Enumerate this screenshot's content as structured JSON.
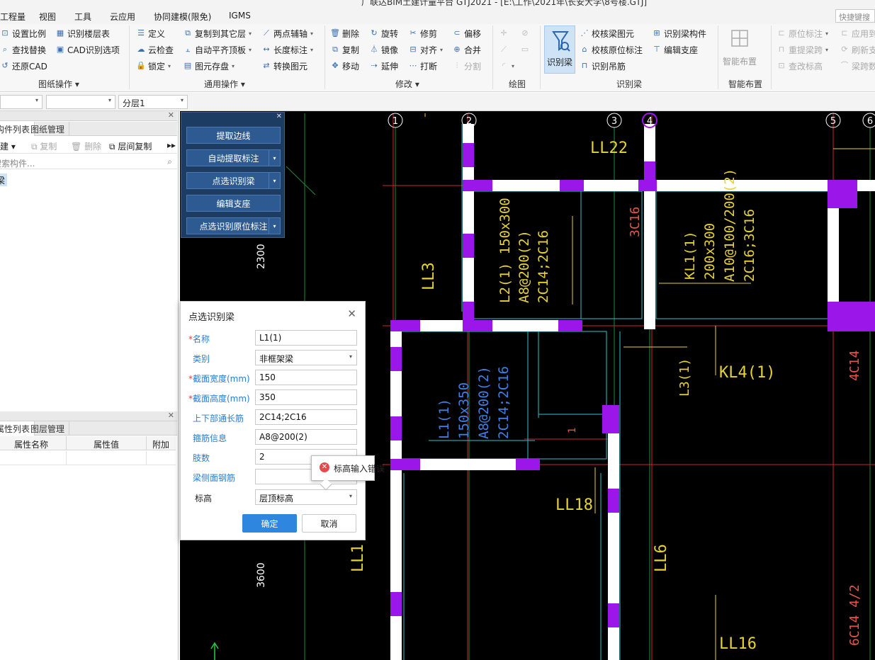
{
  "window": {
    "title": "广联达BIM土建计量平台 GTJ2021 - [E:\\工作\\2021年\\长安大学\\8号楼.GTJ]",
    "quick_search": "快捷键搜"
  },
  "menu": [
    "工程量",
    "视图",
    "工具",
    "云应用",
    "协同建模(限免)",
    "IGMS"
  ],
  "ribbon": {
    "groups": {
      "drawing_ops": "图纸操作",
      "general_ops": "通用操作",
      "modify": "修改",
      "draw": "绘图",
      "recognize_beam": "识别梁",
      "smart_layout": "智能布置"
    },
    "drawing_ops": [
      "设置比例",
      "识别楼层表",
      "查找替换",
      "CAD识别选项",
      "还原CAD"
    ],
    "general_ops": [
      "定义",
      "复制到其它层",
      "两点辅轴",
      "云检查",
      "自动平齐顶板",
      "长度标注",
      "锁定",
      "图元存盘",
      "转换图元"
    ],
    "modify": [
      "删除",
      "旋转",
      "修剪",
      "偏移",
      "复制",
      "镜像",
      "对齐",
      "合并",
      "移动",
      "延伸",
      "打断",
      "分割"
    ],
    "recognize_beam": {
      "big_button": "识别梁",
      "items": [
        "校核梁图元",
        "识别梁构件",
        "校核原位标注",
        "编辑支座",
        "识别吊筋"
      ]
    },
    "smart_layout": "智能布置",
    "right_items": [
      "原位标注",
      "应用到",
      "重提梁跨",
      "刷新支",
      "查改标高",
      "梁跨数"
    ]
  },
  "toolbar": {
    "combo3": "分层1"
  },
  "left_panel": {
    "tabs_top": [
      "构件列表",
      "图纸管理"
    ],
    "tools": [
      "新建",
      "复制",
      "删除",
      "层间复制"
    ],
    "search_placeholder": "搜索构件...",
    "tree_item": "梁",
    "tabs_bottom": [
      "属性列表",
      "图层管理"
    ],
    "prop_headers": [
      "属性名称",
      "属性值",
      "附加"
    ]
  },
  "float_panel": {
    "buttons": [
      "提取边线",
      "自动提取标注",
      "点选识别梁",
      "编辑支座",
      "点选识别原位标注"
    ]
  },
  "dialog": {
    "title": "点选识别梁",
    "fields": [
      {
        "label": "名称",
        "required": true,
        "value": ""
      },
      {
        "label": "类别",
        "required": false,
        "value": "非框架梁"
      },
      {
        "label": "截面宽度(mm)",
        "required": true,
        "value": "150"
      },
      {
        "label": "截面高度(mm)",
        "required": true,
        "value": "350"
      },
      {
        "label": "上下部通长筋",
        "required": false,
        "value": "2C14;2C16"
      },
      {
        "label": "箍筋信息",
        "required": false,
        "value": "A8@200(2)"
      },
      {
        "label": "肢数",
        "required": false,
        "value": "2"
      },
      {
        "label": "梁侧面钢筋",
        "required": false,
        "value": ""
      },
      {
        "label": "标高",
        "required": false,
        "value": "层顶标高"
      }
    ],
    "name_value": "L1(1)",
    "ok": "确定",
    "cancel": "取消"
  },
  "tooltip": {
    "message": "标高输入错误"
  },
  "cad": {
    "axis_numbers": [
      "1",
      "2",
      "3",
      "4",
      "5",
      "6"
    ],
    "dims": [
      "2300",
      "3600"
    ],
    "yellow_labels": [
      "LL22",
      "LL3",
      "L3(1)",
      "KL4(1)",
      "LL18",
      "LL1",
      "LL6",
      "LL16"
    ],
    "kl1": [
      "KL1(1)",
      "200x300",
      "A10@100/200(2)",
      "2C16;3C16"
    ],
    "l2": [
      "L2(1) 150x300",
      "A8@200(2)",
      "2C14;2C16"
    ],
    "l1": [
      "L1(1)",
      "150x350",
      "A8@200(2)",
      "2C14;2C16"
    ],
    "red_labels": [
      "3C16",
      "4C14",
      "6C14 4/2",
      "1"
    ]
  }
}
